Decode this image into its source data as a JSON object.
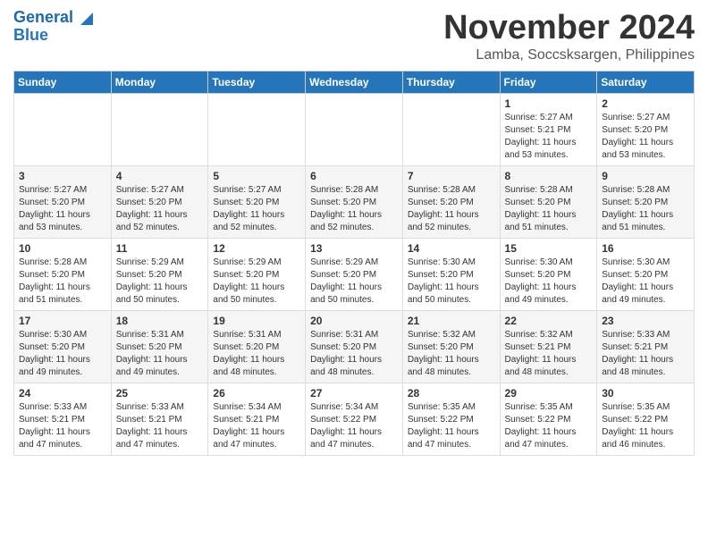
{
  "header": {
    "logo_line1": "General",
    "logo_line2": "Blue",
    "month_title": "November 2024",
    "location": "Lamba, Soccsksargen, Philippines"
  },
  "weekdays": [
    "Sunday",
    "Monday",
    "Tuesday",
    "Wednesday",
    "Thursday",
    "Friday",
    "Saturday"
  ],
  "weeks": [
    [
      {
        "day": "",
        "info": ""
      },
      {
        "day": "",
        "info": ""
      },
      {
        "day": "",
        "info": ""
      },
      {
        "day": "",
        "info": ""
      },
      {
        "day": "",
        "info": ""
      },
      {
        "day": "1",
        "info": "Sunrise: 5:27 AM\nSunset: 5:21 PM\nDaylight: 11 hours and 53 minutes."
      },
      {
        "day": "2",
        "info": "Sunrise: 5:27 AM\nSunset: 5:20 PM\nDaylight: 11 hours and 53 minutes."
      }
    ],
    [
      {
        "day": "3",
        "info": "Sunrise: 5:27 AM\nSunset: 5:20 PM\nDaylight: 11 hours and 53 minutes."
      },
      {
        "day": "4",
        "info": "Sunrise: 5:27 AM\nSunset: 5:20 PM\nDaylight: 11 hours and 52 minutes."
      },
      {
        "day": "5",
        "info": "Sunrise: 5:27 AM\nSunset: 5:20 PM\nDaylight: 11 hours and 52 minutes."
      },
      {
        "day": "6",
        "info": "Sunrise: 5:28 AM\nSunset: 5:20 PM\nDaylight: 11 hours and 52 minutes."
      },
      {
        "day": "7",
        "info": "Sunrise: 5:28 AM\nSunset: 5:20 PM\nDaylight: 11 hours and 52 minutes."
      },
      {
        "day": "8",
        "info": "Sunrise: 5:28 AM\nSunset: 5:20 PM\nDaylight: 11 hours and 51 minutes."
      },
      {
        "day": "9",
        "info": "Sunrise: 5:28 AM\nSunset: 5:20 PM\nDaylight: 11 hours and 51 minutes."
      }
    ],
    [
      {
        "day": "10",
        "info": "Sunrise: 5:28 AM\nSunset: 5:20 PM\nDaylight: 11 hours and 51 minutes."
      },
      {
        "day": "11",
        "info": "Sunrise: 5:29 AM\nSunset: 5:20 PM\nDaylight: 11 hours and 50 minutes."
      },
      {
        "day": "12",
        "info": "Sunrise: 5:29 AM\nSunset: 5:20 PM\nDaylight: 11 hours and 50 minutes."
      },
      {
        "day": "13",
        "info": "Sunrise: 5:29 AM\nSunset: 5:20 PM\nDaylight: 11 hours and 50 minutes."
      },
      {
        "day": "14",
        "info": "Sunrise: 5:30 AM\nSunset: 5:20 PM\nDaylight: 11 hours and 50 minutes."
      },
      {
        "day": "15",
        "info": "Sunrise: 5:30 AM\nSunset: 5:20 PM\nDaylight: 11 hours and 49 minutes."
      },
      {
        "day": "16",
        "info": "Sunrise: 5:30 AM\nSunset: 5:20 PM\nDaylight: 11 hours and 49 minutes."
      }
    ],
    [
      {
        "day": "17",
        "info": "Sunrise: 5:30 AM\nSunset: 5:20 PM\nDaylight: 11 hours and 49 minutes."
      },
      {
        "day": "18",
        "info": "Sunrise: 5:31 AM\nSunset: 5:20 PM\nDaylight: 11 hours and 49 minutes."
      },
      {
        "day": "19",
        "info": "Sunrise: 5:31 AM\nSunset: 5:20 PM\nDaylight: 11 hours and 48 minutes."
      },
      {
        "day": "20",
        "info": "Sunrise: 5:31 AM\nSunset: 5:20 PM\nDaylight: 11 hours and 48 minutes."
      },
      {
        "day": "21",
        "info": "Sunrise: 5:32 AM\nSunset: 5:20 PM\nDaylight: 11 hours and 48 minutes."
      },
      {
        "day": "22",
        "info": "Sunrise: 5:32 AM\nSunset: 5:21 PM\nDaylight: 11 hours and 48 minutes."
      },
      {
        "day": "23",
        "info": "Sunrise: 5:33 AM\nSunset: 5:21 PM\nDaylight: 11 hours and 48 minutes."
      }
    ],
    [
      {
        "day": "24",
        "info": "Sunrise: 5:33 AM\nSunset: 5:21 PM\nDaylight: 11 hours and 47 minutes."
      },
      {
        "day": "25",
        "info": "Sunrise: 5:33 AM\nSunset: 5:21 PM\nDaylight: 11 hours and 47 minutes."
      },
      {
        "day": "26",
        "info": "Sunrise: 5:34 AM\nSunset: 5:21 PM\nDaylight: 11 hours and 47 minutes."
      },
      {
        "day": "27",
        "info": "Sunrise: 5:34 AM\nSunset: 5:22 PM\nDaylight: 11 hours and 47 minutes."
      },
      {
        "day": "28",
        "info": "Sunrise: 5:35 AM\nSunset: 5:22 PM\nDaylight: 11 hours and 47 minutes."
      },
      {
        "day": "29",
        "info": "Sunrise: 5:35 AM\nSunset: 5:22 PM\nDaylight: 11 hours and 47 minutes."
      },
      {
        "day": "30",
        "info": "Sunrise: 5:35 AM\nSunset: 5:22 PM\nDaylight: 11 hours and 46 minutes."
      }
    ]
  ]
}
